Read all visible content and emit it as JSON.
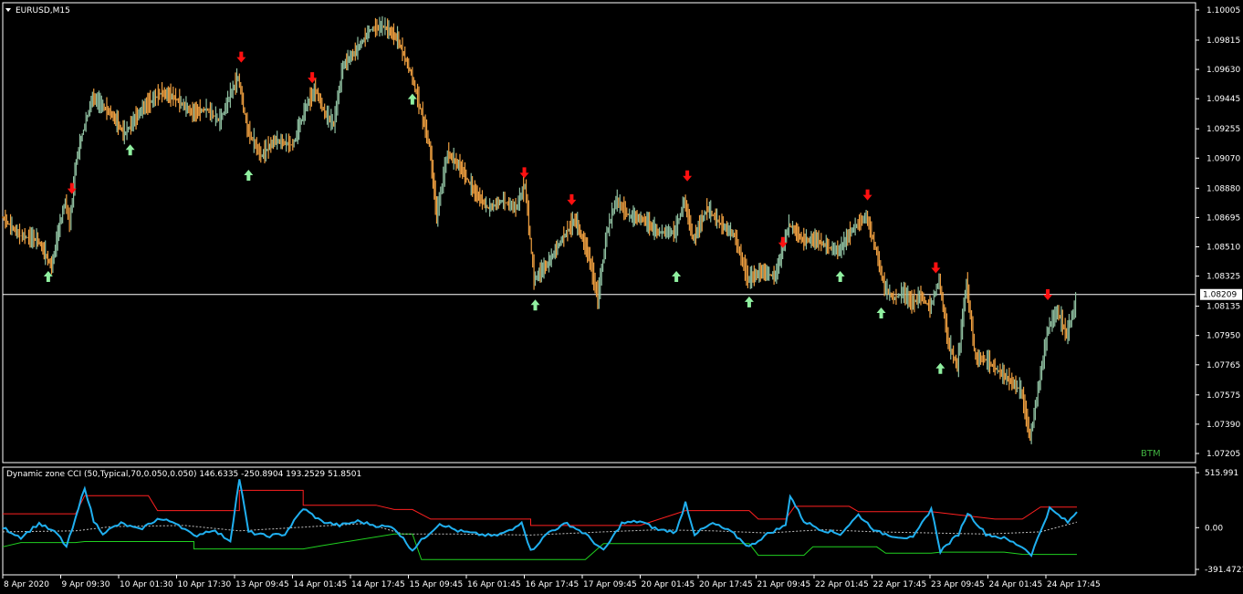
{
  "window": {
    "symbol_label": "EURUSD,M15",
    "watermark": "BTM"
  },
  "colors": {
    "background": "#000000",
    "grid_border": "#ffffff",
    "candle_up": "#8fbfa0",
    "candle_down": "#f0a040",
    "line_mixed": "#a0b890",
    "signal_up": "#90f0a0",
    "signal_down": "#ff1010",
    "price_line": "#ffffff",
    "cci_line": "#20b0f0",
    "upper_zone": "#ff2020",
    "lower_zone": "#20d020",
    "mid_line": "#c0c0c0",
    "watermark": "#40b040"
  },
  "chart_data": [
    {
      "type": "line",
      "name": "price",
      "y_ticks": [
        "1.10005",
        "1.09815",
        "1.09630",
        "1.09445",
        "1.09255",
        "1.09070",
        "1.08880",
        "1.08695",
        "1.08510",
        "1.08325",
        "1.08135",
        "1.07950",
        "1.07765",
        "1.07575",
        "1.07390",
        "1.07205"
      ],
      "current_price_label": "1.08209",
      "current_price": 1.08209,
      "ylim": [
        1.07205,
        1.10005
      ],
      "x_tick_labels": [
        "8 Apr 2020",
        "9 Apr 09:30",
        "10 Apr 01:30",
        "10 Apr 17:30",
        "13 Apr 09:45",
        "14 Apr 01:45",
        "14 Apr 17:45",
        "15 Apr 09:45",
        "16 Apr 01:45",
        "16 Apr 17:45",
        "17 Apr 09:45",
        "20 Apr 01:45",
        "20 Apr 17:45",
        "21 Apr 09:45",
        "22 Apr 01:45",
        "22 Apr 17:45",
        "23 Apr 09:45",
        "24 Apr 01:45",
        "24 Apr 17:45"
      ],
      "series_path": [
        [
          0,
          1.087
        ],
        [
          0.02,
          1.0858
        ],
        [
          0.04,
          1.0855
        ],
        [
          0.055,
          1.0838
        ],
        [
          0.063,
          1.0862
        ],
        [
          0.07,
          1.088
        ],
        [
          0.075,
          1.0865
        ],
        [
          0.082,
          1.0905
        ],
        [
          0.09,
          1.0925
        ],
        [
          0.1,
          1.0945
        ],
        [
          0.12,
          1.0935
        ],
        [
          0.135,
          1.0922
        ],
        [
          0.155,
          1.0938
        ],
        [
          0.175,
          1.0948
        ],
        [
          0.19,
          1.0945
        ],
        [
          0.21,
          1.0935
        ],
        [
          0.225,
          1.0938
        ],
        [
          0.24,
          1.093
        ],
        [
          0.25,
          1.0945
        ],
        [
          0.26,
          1.0958
        ],
        [
          0.27,
          1.0925
        ],
        [
          0.285,
          1.0908
        ],
        [
          0.3,
          1.0918
        ],
        [
          0.32,
          1.0915
        ],
        [
          0.335,
          1.094
        ],
        [
          0.345,
          1.095
        ],
        [
          0.355,
          1.0935
        ],
        [
          0.365,
          1.0928
        ],
        [
          0.375,
          1.0965
        ],
        [
          0.39,
          1.0975
        ],
        [
          0.405,
          1.0988
        ],
        [
          0.42,
          1.099
        ],
        [
          0.435,
          1.0982
        ],
        [
          0.45,
          1.096
        ],
        [
          0.46,
          1.0938
        ],
        [
          0.47,
          1.0915
        ],
        [
          0.478,
          1.087
        ],
        [
          0.49,
          1.091
        ],
        [
          0.505,
          1.09
        ],
        [
          0.52,
          1.0885
        ],
        [
          0.535,
          1.0875
        ],
        [
          0.55,
          1.088
        ],
        [
          0.565,
          1.0875
        ],
        [
          0.575,
          1.089
        ],
        [
          0.585,
          1.083
        ],
        [
          0.6,
          1.084
        ],
        [
          0.615,
          1.0855
        ],
        [
          0.63,
          1.0868
        ],
        [
          0.645,
          1.0845
        ],
        [
          0.655,
          1.0818
        ],
        [
          0.665,
          1.086
        ],
        [
          0.675,
          1.088
        ],
        [
          0.69,
          1.087
        ],
        [
          0.705,
          1.0868
        ],
        [
          0.72,
          1.086
        ],
        [
          0.74,
          1.086
        ],
        [
          0.75,
          1.088
        ],
        [
          0.76,
          1.0855
        ],
        [
          0.775,
          1.0875
        ],
        [
          0.79,
          1.0865
        ],
        [
          0.805,
          1.0858
        ],
        [
          0.82,
          1.083
        ],
        [
          0.835,
          1.0835
        ],
        [
          0.85,
          1.0832
        ],
        [
          0.865,
          1.0865
        ],
        [
          0.88,
          1.0855
        ],
        [
          0.895,
          1.0855
        ],
        [
          0.91,
          1.085
        ],
        [
          0.92,
          1.0848
        ],
        [
          0.935,
          1.0862
        ],
        [
          0.95,
          1.087
        ],
        [
          0.96,
          1.085
        ],
        [
          0.97,
          1.0825
        ],
        [
          0.98,
          1.0818
        ],
        [
          0.99,
          1.0822
        ],
        [
          1.0,
          1.0815
        ],
        [
          1.01,
          1.082
        ],
        [
          1.02,
          1.0812
        ],
        [
          1.03,
          1.083
        ],
        [
          1.04,
          1.079
        ],
        [
          1.05,
          1.0775
        ],
        [
          1.06,
          1.0828
        ],
        [
          1.07,
          1.078
        ],
        [
          1.08,
          1.078
        ],
        [
          1.09,
          1.0775
        ],
        [
          1.1,
          1.077
        ],
        [
          1.12,
          1.076
        ],
        [
          1.13,
          1.073
        ],
        [
          1.14,
          1.0765
        ],
        [
          1.15,
          1.08
        ],
        [
          1.16,
          1.081
        ],
        [
          1.17,
          1.0795
        ],
        [
          1.18,
          1.0815
        ]
      ],
      "signals_up": [
        [
          0.05,
          1.0838
        ],
        [
          0.14,
          1.0918
        ],
        [
          0.27,
          1.0902
        ],
        [
          0.45,
          1.095
        ],
        [
          0.585,
          1.082
        ],
        [
          0.74,
          1.0838
        ],
        [
          0.82,
          1.0822
        ],
        [
          0.92,
          1.0838
        ],
        [
          0.965,
          1.0815
        ],
        [
          1.03,
          1.078
        ]
      ],
      "signals_down": [
        [
          0.076,
          1.0882
        ],
        [
          0.262,
          1.0965
        ],
        [
          0.34,
          1.0952
        ],
        [
          0.573,
          1.0892
        ],
        [
          0.625,
          1.0875
        ],
        [
          0.752,
          1.089
        ],
        [
          0.857,
          1.0848
        ],
        [
          0.95,
          1.0878
        ],
        [
          1.025,
          1.0832
        ],
        [
          1.148,
          1.0815
        ]
      ]
    },
    {
      "type": "line",
      "name": "Dynamic zone CCI",
      "indicator_label": "Dynamic zone CCI (50,Typical,70,0.050,0.050) 146.6335 -250.8904 193.2529 51.8501",
      "y_ticks": [
        "515.991",
        "0.00",
        "-391.4721"
      ],
      "ylim": [
        -391.4721,
        515.991
      ],
      "cci": [
        [
          0,
          0
        ],
        [
          0.02,
          -90
        ],
        [
          0.04,
          40
        ],
        [
          0.06,
          -60
        ],
        [
          0.07,
          -180
        ],
        [
          0.08,
          80
        ],
        [
          0.09,
          380
        ],
        [
          0.1,
          60
        ],
        [
          0.11,
          -50
        ],
        [
          0.13,
          40
        ],
        [
          0.15,
          -20
        ],
        [
          0.17,
          80
        ],
        [
          0.19,
          50
        ],
        [
          0.21,
          -80
        ],
        [
          0.23,
          -20
        ],
        [
          0.25,
          -120
        ],
        [
          0.26,
          460
        ],
        [
          0.27,
          -40
        ],
        [
          0.29,
          -80
        ],
        [
          0.31,
          -60
        ],
        [
          0.33,
          180
        ],
        [
          0.35,
          60
        ],
        [
          0.37,
          20
        ],
        [
          0.39,
          60
        ],
        [
          0.41,
          20
        ],
        [
          0.43,
          0
        ],
        [
          0.45,
          -210
        ],
        [
          0.46,
          -120
        ],
        [
          0.48,
          40
        ],
        [
          0.5,
          -30
        ],
        [
          0.52,
          -60
        ],
        [
          0.54,
          -80
        ],
        [
          0.56,
          -20
        ],
        [
          0.57,
          60
        ],
        [
          0.58,
          -220
        ],
        [
          0.6,
          -40
        ],
        [
          0.62,
          40
        ],
        [
          0.64,
          -60
        ],
        [
          0.66,
          -220
        ],
        [
          0.68,
          40
        ],
        [
          0.7,
          60
        ],
        [
          0.72,
          -20
        ],
        [
          0.74,
          -40
        ],
        [
          0.75,
          240
        ],
        [
          0.76,
          -60
        ],
        [
          0.78,
          40
        ],
        [
          0.8,
          -40
        ],
        [
          0.82,
          -180
        ],
        [
          0.84,
          -60
        ],
        [
          0.86,
          20
        ],
        [
          0.865,
          300
        ],
        [
          0.88,
          60
        ],
        [
          0.9,
          -20
        ],
        [
          0.92,
          -60
        ],
        [
          0.94,
          120
        ],
        [
          0.96,
          -40
        ],
        [
          0.98,
          -80
        ],
        [
          1.0,
          -100
        ],
        [
          1.02,
          180
        ],
        [
          1.03,
          -220
        ],
        [
          1.05,
          -60
        ],
        [
          1.06,
          140
        ],
        [
          1.08,
          -60
        ],
        [
          1.1,
          -100
        ],
        [
          1.12,
          -180
        ],
        [
          1.13,
          -250
        ],
        [
          1.15,
          180
        ],
        [
          1.17,
          50
        ],
        [
          1.18,
          147
        ]
      ],
      "upper_zone": [
        [
          0,
          130
        ],
        [
          0.08,
          130
        ],
        [
          0.09,
          300
        ],
        [
          0.16,
          300
        ],
        [
          0.17,
          160
        ],
        [
          0.26,
          160
        ],
        [
          0.26,
          350
        ],
        [
          0.33,
          350
        ],
        [
          0.33,
          210
        ],
        [
          0.41,
          210
        ],
        [
          0.43,
          170
        ],
        [
          0.45,
          170
        ],
        [
          0.47,
          80
        ],
        [
          0.58,
          80
        ],
        [
          0.58,
          20
        ],
        [
          0.7,
          20
        ],
        [
          0.75,
          160
        ],
        [
          0.82,
          160
        ],
        [
          0.83,
          80
        ],
        [
          0.86,
          80
        ],
        [
          0.87,
          200
        ],
        [
          0.93,
          200
        ],
        [
          0.94,
          150
        ],
        [
          1.02,
          150
        ],
        [
          1.05,
          120
        ],
        [
          1.09,
          80
        ],
        [
          1.12,
          80
        ],
        [
          1.14,
          193
        ],
        [
          1.18,
          193
        ]
      ],
      "lower_zone": [
        [
          0,
          -180
        ],
        [
          0.02,
          -140
        ],
        [
          0.08,
          -140
        ],
        [
          0.09,
          -130
        ],
        [
          0.21,
          -130
        ],
        [
          0.21,
          -200
        ],
        [
          0.33,
          -200
        ],
        [
          0.35,
          -170
        ],
        [
          0.43,
          -60
        ],
        [
          0.45,
          -60
        ],
        [
          0.46,
          -300
        ],
        [
          0.58,
          -300
        ],
        [
          0.6,
          -300
        ],
        [
          0.64,
          -300
        ],
        [
          0.66,
          -150
        ],
        [
          0.74,
          -150
        ],
        [
          0.75,
          -150
        ],
        [
          0.82,
          -150
        ],
        [
          0.83,
          -260
        ],
        [
          0.88,
          -260
        ],
        [
          0.89,
          -180
        ],
        [
          0.96,
          -180
        ],
        [
          0.97,
          -240
        ],
        [
          1.02,
          -240
        ],
        [
          1.03,
          -230
        ],
        [
          1.1,
          -230
        ],
        [
          1.12,
          -250
        ],
        [
          1.14,
          -251
        ],
        [
          1.18,
          -251
        ]
      ],
      "mid_line": [
        [
          0,
          -40
        ],
        [
          0.08,
          -30
        ],
        [
          0.12,
          10
        ],
        [
          0.2,
          20
        ],
        [
          0.26,
          -30
        ],
        [
          0.32,
          0
        ],
        [
          0.4,
          40
        ],
        [
          0.44,
          -60
        ],
        [
          0.5,
          -60
        ],
        [
          0.58,
          -70
        ],
        [
          0.66,
          -40
        ],
        [
          0.72,
          -20
        ],
        [
          0.78,
          -30
        ],
        [
          0.84,
          -50
        ],
        [
          0.9,
          -20
        ],
        [
          0.96,
          -40
        ],
        [
          1.02,
          -50
        ],
        [
          1.08,
          -60
        ],
        [
          1.14,
          -40
        ],
        [
          1.18,
          52
        ]
      ]
    }
  ]
}
